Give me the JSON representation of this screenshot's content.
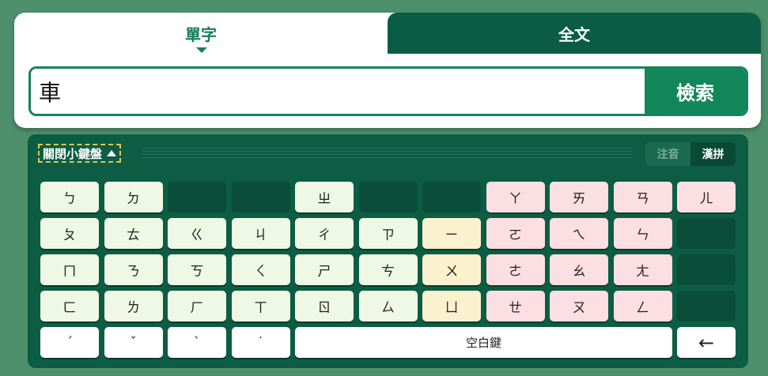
{
  "tabs": {
    "single": "單字",
    "full": "全文"
  },
  "search": {
    "value": "車",
    "button": "檢索"
  },
  "keyboard": {
    "close_label": "關閉小鍵盤",
    "modes": [
      "注音",
      "漢拼"
    ],
    "active_mode": "漢拼",
    "rows": [
      [
        {
          "t": "ㄅ",
          "c": "green"
        },
        {
          "t": "ㄉ",
          "c": "green"
        },
        {
          "t": "",
          "c": "empty"
        },
        {
          "t": "",
          "c": "empty"
        },
        {
          "t": "ㄓ",
          "c": "green"
        },
        {
          "t": "",
          "c": "empty"
        },
        {
          "t": "",
          "c": "empty"
        },
        {
          "t": "ㄚ",
          "c": "pink"
        },
        {
          "t": "ㄞ",
          "c": "pink"
        },
        {
          "t": "ㄢ",
          "c": "pink"
        },
        {
          "t": "ㄦ",
          "c": "pink"
        }
      ],
      [
        {
          "t": "ㄆ",
          "c": "green"
        },
        {
          "t": "ㄊ",
          "c": "green"
        },
        {
          "t": "ㄍ",
          "c": "green"
        },
        {
          "t": "ㄐ",
          "c": "green"
        },
        {
          "t": "ㄔ",
          "c": "green"
        },
        {
          "t": "ㄗ",
          "c": "green"
        },
        {
          "t": "ㄧ",
          "c": "yellow"
        },
        {
          "t": "ㄛ",
          "c": "pink"
        },
        {
          "t": "ㄟ",
          "c": "pink"
        },
        {
          "t": "ㄣ",
          "c": "pink"
        },
        {
          "t": "",
          "c": "empty"
        }
      ],
      [
        {
          "t": "ㄇ",
          "c": "green"
        },
        {
          "t": "ㄋ",
          "c": "green"
        },
        {
          "t": "ㄎ",
          "c": "green"
        },
        {
          "t": "ㄑ",
          "c": "green"
        },
        {
          "t": "ㄕ",
          "c": "green"
        },
        {
          "t": "ㄘ",
          "c": "green"
        },
        {
          "t": "ㄨ",
          "c": "yellow"
        },
        {
          "t": "ㄜ",
          "c": "pink"
        },
        {
          "t": "ㄠ",
          "c": "pink"
        },
        {
          "t": "ㄤ",
          "c": "pink"
        },
        {
          "t": "",
          "c": "empty"
        }
      ],
      [
        {
          "t": "ㄈ",
          "c": "green"
        },
        {
          "t": "ㄌ",
          "c": "green"
        },
        {
          "t": "ㄏ",
          "c": "green"
        },
        {
          "t": "ㄒ",
          "c": "green"
        },
        {
          "t": "ㄖ",
          "c": "green"
        },
        {
          "t": "ㄙ",
          "c": "green"
        },
        {
          "t": "ㄩ",
          "c": "yellow"
        },
        {
          "t": "ㄝ",
          "c": "pink"
        },
        {
          "t": "ㄡ",
          "c": "pink"
        },
        {
          "t": "ㄥ",
          "c": "pink"
        },
        {
          "t": "",
          "c": "empty"
        }
      ]
    ],
    "bottom": {
      "tone2": "ˊ",
      "tone3": "ˇ",
      "tone4": "ˋ",
      "tone5": "˙",
      "space": "空白鍵",
      "backspace": "←"
    }
  }
}
